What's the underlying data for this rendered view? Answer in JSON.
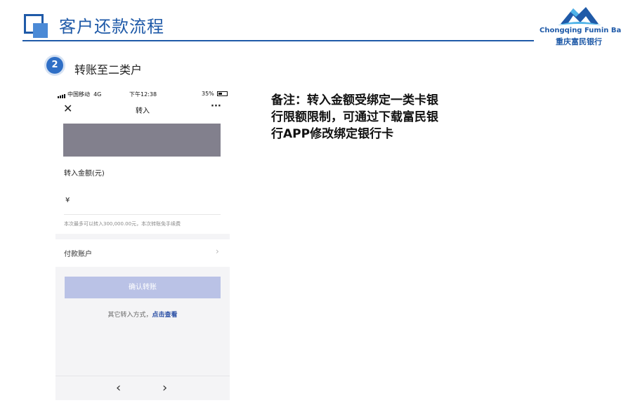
{
  "header": {
    "title": "客户还款流程",
    "brand_color": "#1f5aa8",
    "logo": {
      "name_en": "Chongqing Fumin Bank",
      "name_cn": "重庆富民银行"
    }
  },
  "step": {
    "number": "2",
    "label": "转账至二类户"
  },
  "phone": {
    "status_bar": {
      "carrier": "中国移动",
      "network": "4G",
      "time": "下午12:38",
      "battery": "35%"
    },
    "nav": {
      "close_icon": "close-icon",
      "title": "转入",
      "more_icon": "more-icon"
    },
    "amount": {
      "label": "转入金额(元)",
      "currency_symbol": "¥",
      "value": "",
      "limit_note": "本次最多可以转入300,000.00元，本次转账免手续费"
    },
    "payment_account": {
      "label": "付款账户",
      "chevron_icon": "chevron-right-icon"
    },
    "confirm_button": {
      "label": "确认转账",
      "color": "#bac2e6"
    },
    "other_methods": {
      "prefix": "其它转入方式，",
      "link": "点击查看",
      "link_color": "#2a4fa5"
    },
    "bottom_nav": {
      "back_icon": "back-icon",
      "forward_icon": "forward-icon"
    }
  },
  "note": {
    "text": "备注：转入金额受绑定一类卡银行限额限制，可通过下载富民银行APP修改绑定银行卡"
  }
}
